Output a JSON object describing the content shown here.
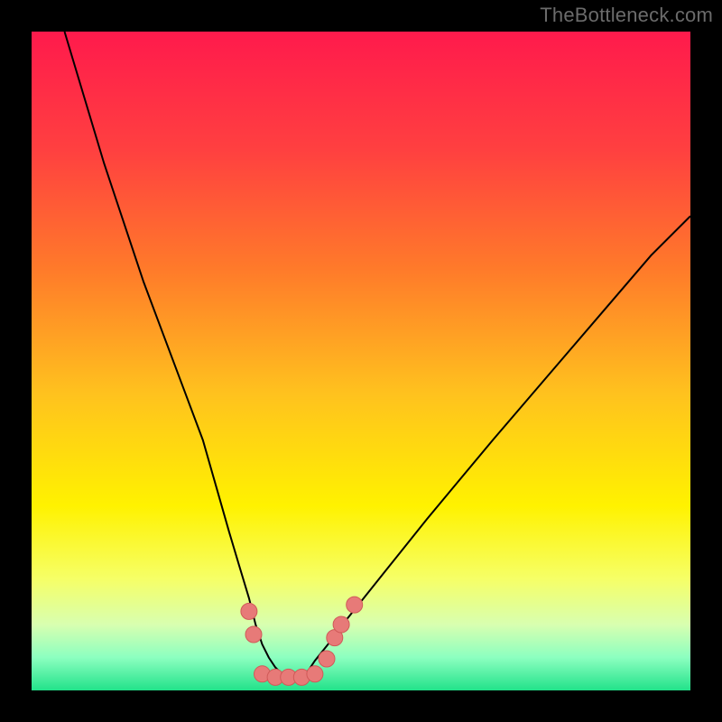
{
  "watermark": "TheBottleneck.com",
  "chart_data": {
    "type": "line",
    "title": "",
    "xlabel": "",
    "ylabel": "",
    "xlim": [
      0,
      100
    ],
    "ylim": [
      0,
      100
    ],
    "grid": false,
    "legend": false,
    "background_gradient": {
      "stops": [
        {
          "offset": 0.0,
          "color": "#ff1a4c"
        },
        {
          "offset": 0.18,
          "color": "#ff4040"
        },
        {
          "offset": 0.36,
          "color": "#ff7a2a"
        },
        {
          "offset": 0.55,
          "color": "#ffc21e"
        },
        {
          "offset": 0.72,
          "color": "#fff200"
        },
        {
          "offset": 0.83,
          "color": "#f6ff66"
        },
        {
          "offset": 0.9,
          "color": "#d8ffb0"
        },
        {
          "offset": 0.95,
          "color": "#8cffc0"
        },
        {
          "offset": 1.0,
          "color": "#22e28a"
        }
      ]
    },
    "series": [
      {
        "name": "curve",
        "stroke": "#000000",
        "x": [
          5,
          8,
          11,
          14,
          17,
          20,
          23,
          26,
          28,
          30,
          31.5,
          33,
          34,
          35,
          36,
          37,
          38,
          39,
          40,
          41,
          42,
          43,
          45,
          48,
          52,
          56,
          60,
          65,
          70,
          76,
          82,
          88,
          94,
          100
        ],
        "y": [
          100,
          90,
          80,
          71,
          62,
          54,
          46,
          38,
          31,
          24,
          19,
          14,
          10,
          7,
          5,
          3.5,
          2.5,
          2,
          2,
          2.5,
          3,
          4.5,
          7,
          11,
          16,
          21,
          26,
          32,
          38,
          45,
          52,
          59,
          66,
          72
        ]
      },
      {
        "name": "markers",
        "type": "scatter",
        "fill": "#e77a78",
        "stroke": "#d05a58",
        "r": 9,
        "points": [
          {
            "x": 33.0,
            "y": 12.0
          },
          {
            "x": 33.7,
            "y": 8.5
          },
          {
            "x": 35.0,
            "y": 2.5
          },
          {
            "x": 37.0,
            "y": 2.0
          },
          {
            "x": 39.0,
            "y": 2.0
          },
          {
            "x": 41.0,
            "y": 2.0
          },
          {
            "x": 43.0,
            "y": 2.5
          },
          {
            "x": 44.8,
            "y": 4.8
          },
          {
            "x": 46.0,
            "y": 8.0
          },
          {
            "x": 47.0,
            "y": 10.0
          },
          {
            "x": 49.0,
            "y": 13.0
          }
        ]
      }
    ],
    "annotations": []
  }
}
